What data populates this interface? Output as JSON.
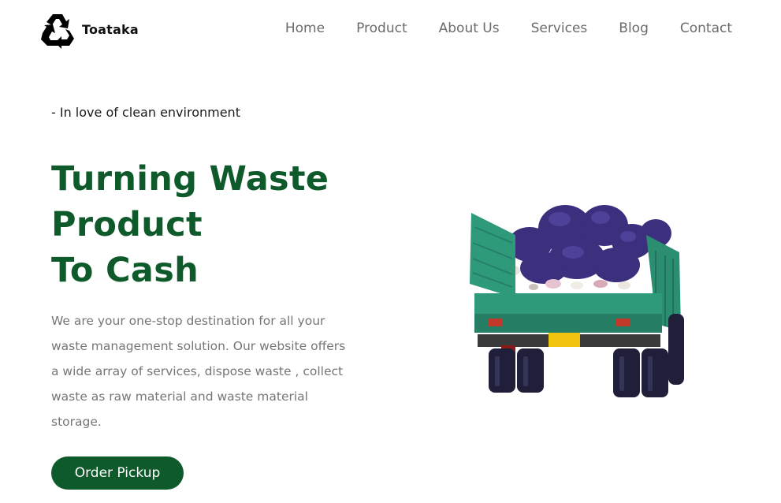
{
  "brand": {
    "name": "Toataka",
    "logo_icon": "recycle-icon"
  },
  "nav": {
    "items": [
      {
        "label": "Home"
      },
      {
        "label": "Product"
      },
      {
        "label": "About Us"
      },
      {
        "label": "Services"
      },
      {
        "label": "Blog"
      },
      {
        "label": "Contact"
      }
    ]
  },
  "hero": {
    "tagline": "- In love of clean environment",
    "headline_lines": [
      "Turning Waste",
      "Product",
      "To Cash"
    ],
    "description": "We are your one-stop destination for all your waste management solution. Our website offers a wide array of services, dispose waste , collect waste as raw material and waste material storage.",
    "cta_label": "Order Pickup",
    "image_icon": "garbage-truck-image"
  },
  "colors": {
    "brand_green": "#0f5a2b",
    "nav_text": "#6b6b6b",
    "body_text": "#767676",
    "truck_teal": "#2f9a7a",
    "bag_purple": "#3b2f7e"
  }
}
